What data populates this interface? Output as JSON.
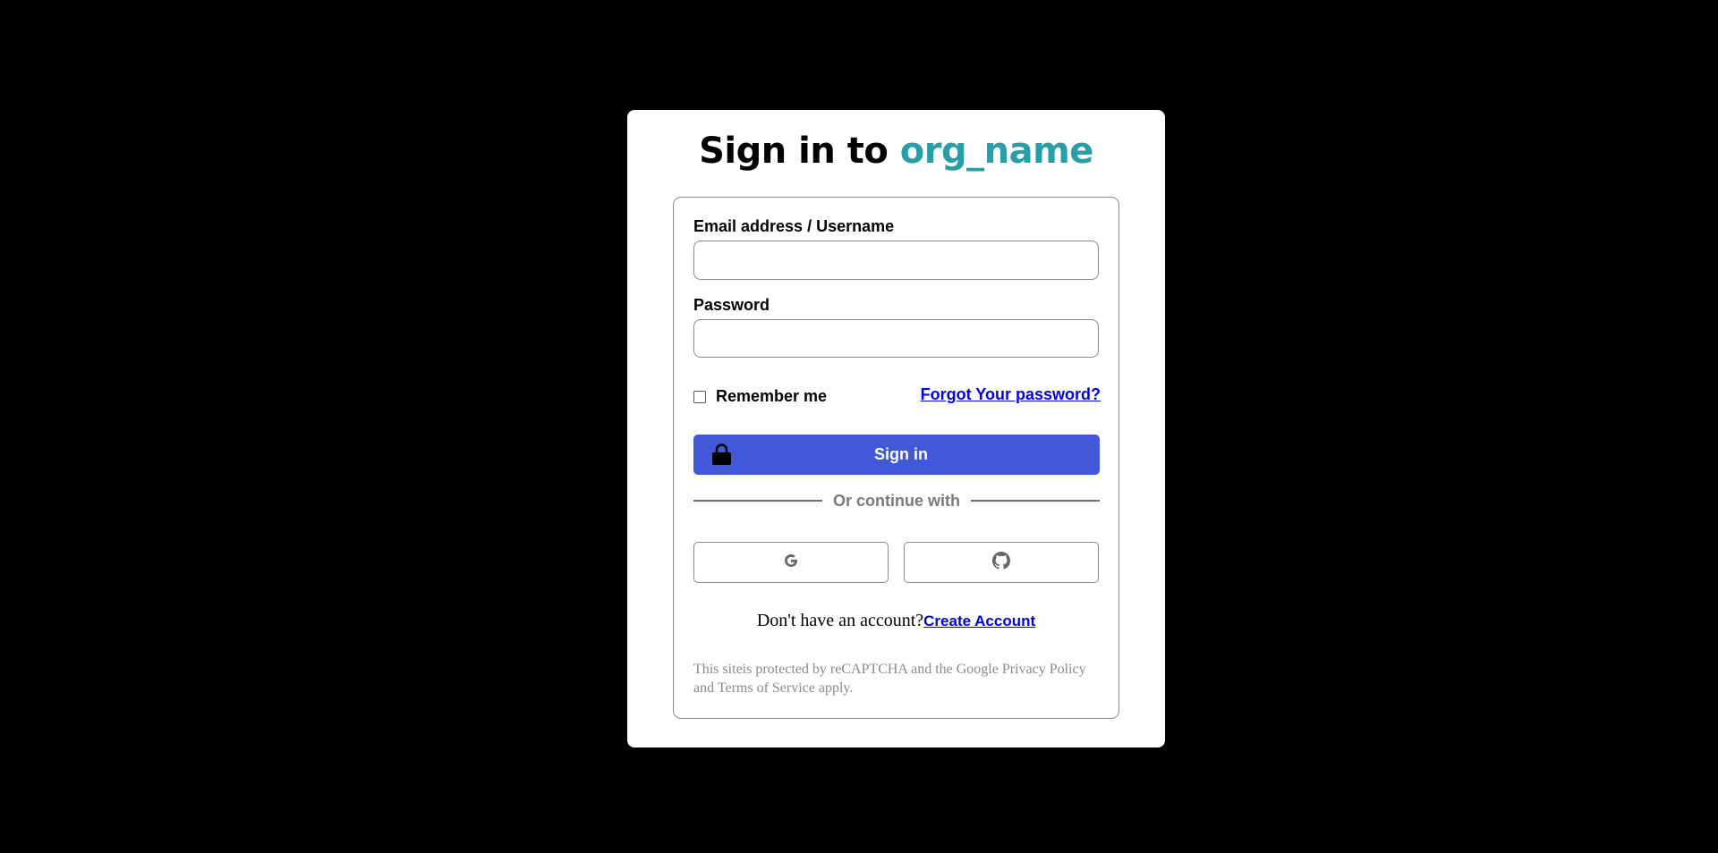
{
  "title": {
    "prefix": "Sign in to ",
    "org": "org_name"
  },
  "form": {
    "email_label": "Email address / Username",
    "email_value": "",
    "password_label": "Password",
    "password_value": "",
    "remember_label": "Remember me",
    "remember_checked": false,
    "forgot_link": "Forgot Your password?",
    "signin_label": "Sign in",
    "signin_icon": "lock-icon",
    "divider_text": "Or continue with",
    "social": [
      {
        "provider": "Google",
        "icon": "google-icon"
      },
      {
        "provider": "GitHub",
        "icon": "github-icon"
      }
    ]
  },
  "footer": {
    "account_prompt": "Don't have an account?",
    "create_link": "Create Account",
    "recaptcha_note": "This siteis protected by reCAPTCHA and the Google Privacy Policy and Terms of Service apply."
  },
  "colors": {
    "background": "#000000",
    "card": "#ffffff",
    "accent_org": "#2a9ea8",
    "primary_button": "#4159d9",
    "link": "#0000ee"
  }
}
